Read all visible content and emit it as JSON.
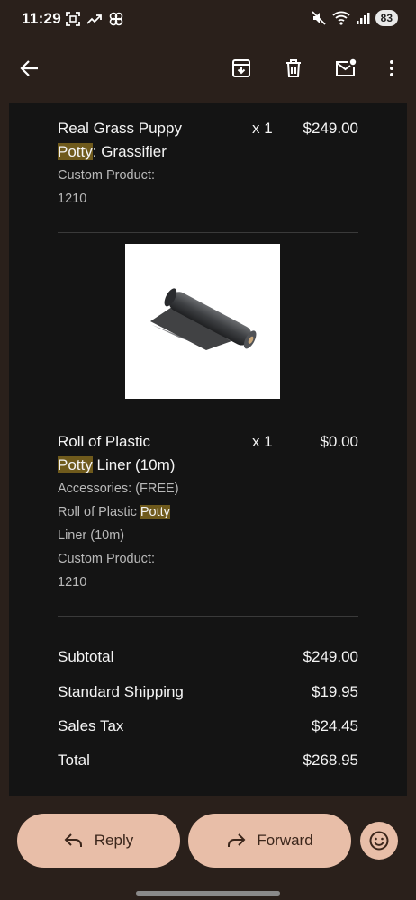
{
  "status": {
    "time": "11:29",
    "battery": "83"
  },
  "toolbar": {
    "icons": [
      "back-arrow-icon",
      "archive-icon",
      "delete-icon",
      "mark-unread-icon",
      "more-vert-icon"
    ]
  },
  "order": {
    "items": [
      {
        "title_pre": "Real Grass Puppy",
        "title_hl": "Potty",
        "title_post": ": Grassifier",
        "qty": "x 1",
        "price": "$249.00",
        "meta": [
          "Custom Product:",
          "1210"
        ]
      },
      {
        "title_pre": "Roll of Plastic",
        "title_hl": "Potty",
        "title_post": "Liner (10m)",
        "qty": "x 1",
        "price": "$0.00",
        "meta_accessories": "Accessories: (FREE)",
        "meta_line2_pre": "Roll of Plastic",
        "meta_line2_hl": "Potty",
        "meta_line3": "Liner (10m)",
        "meta_custom": "Custom Product:",
        "meta_custom_val": "1210"
      }
    ],
    "summary": [
      {
        "label": "Subtotal",
        "value": "$249.00"
      },
      {
        "label": "Standard Shipping",
        "value": "$19.95"
      },
      {
        "label": "Sales Tax",
        "value": "$24.45"
      },
      {
        "label": "Total",
        "value": "$268.95"
      }
    ]
  },
  "actions": {
    "reply": "Reply",
    "forward": "Forward"
  },
  "colors": {
    "background": "#2a201b",
    "card": "#141414",
    "highlight": "#6f5a1c",
    "pill": "#e8bea8"
  }
}
